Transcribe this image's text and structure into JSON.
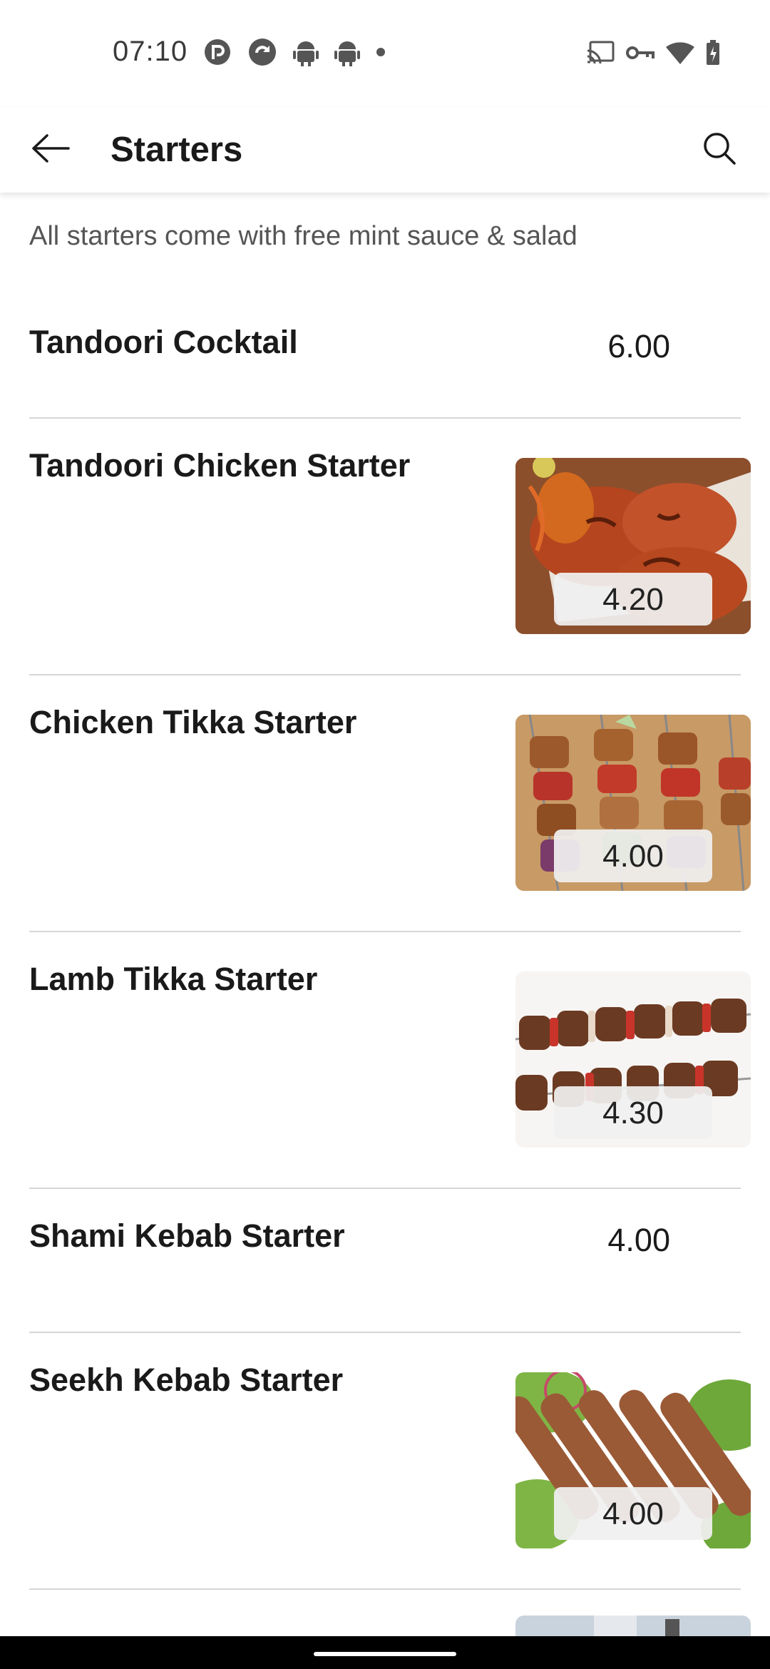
{
  "status_bar": {
    "time": "07:10",
    "left_icons": [
      "pocket-casts-icon",
      "sync-app-icon",
      "android-icon",
      "android-icon",
      "dot-icon"
    ],
    "right_icons": [
      "cast-icon",
      "vpn-key-icon",
      "wifi-icon",
      "battery-charging-icon"
    ]
  },
  "app_bar": {
    "title": "Starters",
    "back_icon": "arrow-left-icon",
    "search_icon": "search-icon"
  },
  "category": {
    "note": "All starters come with free mint sauce & salad"
  },
  "items": [
    {
      "name": "Tandoori Cocktail",
      "price": "6.00",
      "has_image": false
    },
    {
      "name": "Tandoori Chicken Starter",
      "price": "4.20",
      "has_image": true,
      "image": "tandoori-chicken-photo"
    },
    {
      "name": "Chicken Tikka Starter",
      "price": "4.00",
      "has_image": true,
      "image": "chicken-tikka-skewers-photo"
    },
    {
      "name": "Lamb Tikka Starter",
      "price": "4.30",
      "has_image": true,
      "image": "lamb-tikka-skewers-photo"
    },
    {
      "name": "Shami Kebab Starter",
      "price": "4.00",
      "has_image": false
    },
    {
      "name": "Seekh Kebab Starter",
      "price": "4.00",
      "has_image": true,
      "image": "seekh-kebab-photo"
    }
  ],
  "colors": {
    "text_primary": "#1a1a1a",
    "text_secondary": "#555555",
    "divider": "#d6d6d6",
    "badge_bg": "#f0f0f0"
  }
}
